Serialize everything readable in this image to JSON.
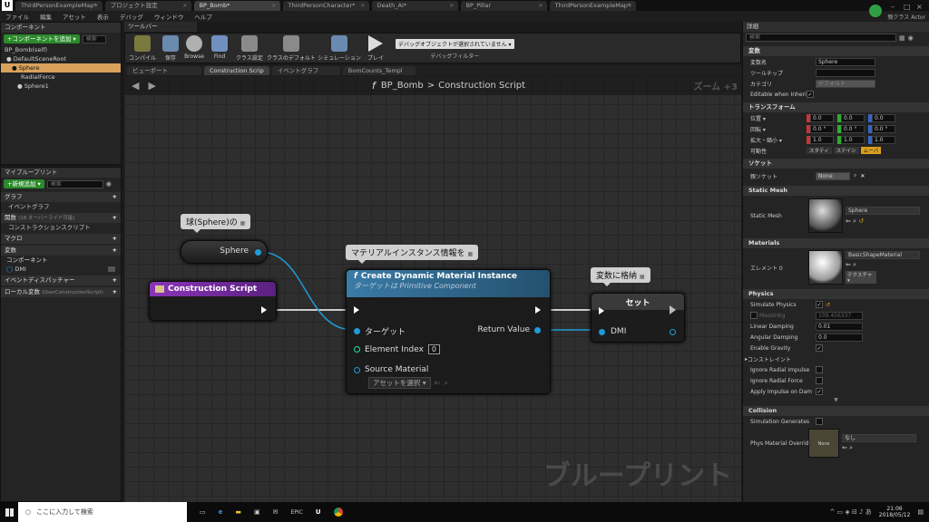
{
  "titlebar": {
    "tabs": [
      "ThirdPersonExampleMap*",
      "プロジェクト設定",
      "BP_Bomb*",
      "ThirdPersonCharacter*",
      "Death_AI*",
      "BP_Pillar",
      "ThirdPersonExampleMap*"
    ],
    "active_tab": 2,
    "right_label": "親クラス Actor"
  },
  "menubar": [
    "ファイル",
    "編集",
    "アセット",
    "表示",
    "デバッグ",
    "ウィンドウ",
    "ヘルプ"
  ],
  "components": {
    "title": "コンポーネント",
    "add_button": "+コンポーネントを追加 ▾",
    "search": "検索",
    "self": "BP_Bomb(self)",
    "tree": [
      "DefaultSceneRoot",
      "Sphere",
      "RadialForce",
      "Sphere1"
    ]
  },
  "my_blueprint": {
    "title": "マイブループリント",
    "add_button": "+新規追加 ▾",
    "search": "検索",
    "sections": {
      "graph": "グラフ",
      "event_graph": "イベントグラフ",
      "functions": "関数",
      "functions_sub": "(18 オーバーライド可能)",
      "construction": "コンストラクションスクリプト",
      "macros": "マクロ",
      "variables": "変数",
      "components": "コンポーネント",
      "dmi": "DMI",
      "dispatchers": "イベントディスパッチャー",
      "local_vars": "ローカル変数",
      "local_vars_sub": "(UserConstructionScript)"
    }
  },
  "toolbar": {
    "title": "ツールバー",
    "buttons": [
      "コンパイル",
      "保存",
      "Browse",
      "Find",
      "クラス設定",
      "クラスのデフォルト",
      "シミュレーション",
      "プレイ"
    ],
    "debug_select": "デバッグオブジェクトが選択されていません ▾",
    "debug_filter": "デバッグフィルター"
  },
  "editor_tabs": [
    "ビューポート",
    "Construction Scrip",
    "イベントグラフ",
    "BomCounts_Templ"
  ],
  "graph": {
    "breadcrumb_root": "BP_Bomb",
    "breadcrumb_sep": ">",
    "breadcrumb_leaf": "Construction Script",
    "zoom": "ズーム +3",
    "watermark": "ブループリント",
    "comment_sphere": "球(Sphere)の",
    "comment_material": "マテリアルインスタンス情報を",
    "comment_set": "変数に格納",
    "sphere_node": "Sphere",
    "construction_node": "Construction Script",
    "cdmi_title": "Create Dynamic Material Instance",
    "cdmi_sub": "ターゲットは Primitive Component",
    "cdmi_target": "ターゲット",
    "cdmi_index": "Element Index",
    "cdmi_index_val": "0",
    "cdmi_source": "Source Material",
    "cdmi_source_val": "アセットを選択 ▾",
    "cdmi_return": "Return Value",
    "set_title": "セット",
    "set_var": "DMI"
  },
  "details": {
    "title": "詳細",
    "search": "検索",
    "cat_variable": "変数",
    "var_name_label": "変数名",
    "var_name": "Sphere",
    "tooltip_label": "ツールチップ",
    "category_label": "カテゴリ",
    "category": "デフォルト",
    "editable_label": "Editable when Inherited",
    "cat_transform": "トランスフォーム",
    "location_label": "位置 ▾",
    "location": [
      "0.0",
      "0.0",
      "0.0"
    ],
    "rotation_label": "回転 ▾",
    "rotation": [
      "0.0 °",
      "0.0 °",
      "0.0 °"
    ],
    "scale_label": "拡大・縮小 ▾",
    "scale": [
      "1.0",
      "1.0",
      "1.0"
    ],
    "mobility_label": "可動性",
    "mobility": [
      "スタティ",
      "ステイシ",
      "ムーバ"
    ],
    "cat_sockets": "ソケット",
    "parent_socket_label": "親ソケット",
    "parent_socket": "None",
    "cat_static_mesh": "Static Mesh",
    "static_mesh_label": "Static Mesh",
    "static_mesh": "Sphere",
    "cat_materials": "Materials",
    "element_label": "エレメント 0",
    "element_material": "BasicShapeMaterial",
    "texture_btn": "テクスチャ ▾",
    "cat_physics": "Physics",
    "simulate_label": "Simulate Physics",
    "mass_label": "MassInKg",
    "mass_val": "109.456337",
    "linear_label": "Linear Damping",
    "linear_val": "0.01",
    "angular_label": "Angular Damping",
    "angular_val": "0.0",
    "gravity_label": "Enable Gravity",
    "constraints_label": "コンストレイント",
    "ign_impulse_label": "Ignore Radial Impulse",
    "ign_force_label": "Ignore Radial Force",
    "apply_impulse_label": "Apply Impulse on Dam",
    "cat_collision": "Collision",
    "sim_gen_label": "Simulation Generates",
    "phys_mat_label": "Phys Material Overrid",
    "phys_mat_val": "なし",
    "phys_thumb": "None"
  },
  "taskbar": {
    "search": "ここに入力して検索",
    "time": "21:06",
    "date": "2018/05/12"
  },
  "colors": {
    "exec": "#ffffff",
    "object_pin": "#1e9bd7",
    "int_pin": "#1fe0a8",
    "construction_header": "#7d2fa8",
    "function_header": "#2d6a8f",
    "set_header": "#2f2f2f"
  }
}
